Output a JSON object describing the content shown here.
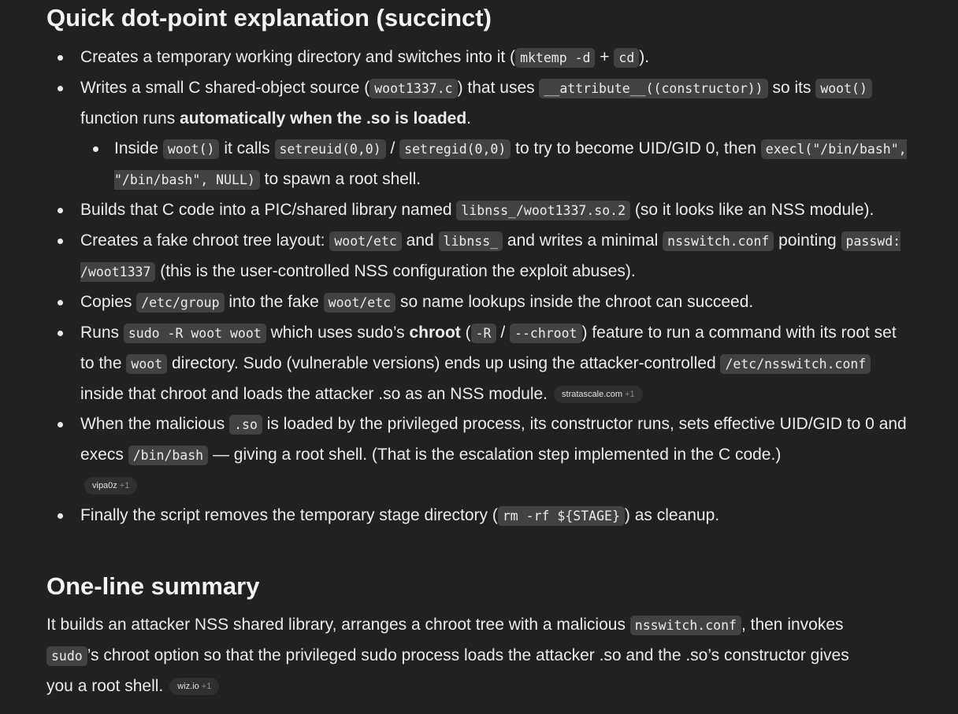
{
  "headings": {
    "explanation": "Quick dot-point explanation (succinct)",
    "summary": "One-line summary"
  },
  "b1": {
    "t1": "Creates a temporary working directory and switches into it (",
    "c1": "mktemp -d",
    "t2": " + ",
    "c2": "cd",
    "t3": ")."
  },
  "b2": {
    "t1": "Writes a small C shared-object source (",
    "c1": "woot1337.c",
    "t2": ") that uses ",
    "c2": "__attribute__((constructor))",
    "t3": " so its ",
    "c3": "woot()",
    "t4": " function runs ",
    "b1": "automatically when the .so is loaded",
    "t5": "."
  },
  "b2s": {
    "t1": "Inside ",
    "c1": "woot()",
    "t2": " it calls ",
    "c2": "setreuid(0,0)",
    "t3": " / ",
    "c3": "setregid(0,0)",
    "t4": " to try to become UID/GID 0, then ",
    "c4": "execl(\"/bin/bash\", \"/bin/bash\", NULL)",
    "t5": " to spawn a root shell."
  },
  "b3": {
    "t1": "Builds that C code into a PIC/shared library named ",
    "c1": "libnss_/woot1337.so.2",
    "t2": " (so it looks like an NSS module)."
  },
  "b4": {
    "t1": "Creates a fake chroot tree layout: ",
    "c1": "woot/etc",
    "t2": " and ",
    "c2": "libnss_",
    "t3": " and writes a minimal ",
    "c3": "nsswitch.conf",
    "t4": " pointing ",
    "c4": "passwd: /woot1337",
    "t5": " (this is the user-controlled NSS configuration the exploit abuses)."
  },
  "b5": {
    "t1": "Copies ",
    "c1": "/etc/group",
    "t2": " into the fake ",
    "c2": "woot/etc",
    "t3": " so name lookups inside the chroot can succeed."
  },
  "b6": {
    "t1": "Runs ",
    "c1": "sudo -R woot woot",
    "t2": " which uses sudo’s ",
    "b1": "chroot",
    "t3": " (",
    "c2": "-R",
    "t4": " / ",
    "c3": "--chroot",
    "t5": ") feature to run a command with its root set to the ",
    "c4": "woot",
    "t6": " directory. Sudo (vulnerable versions) ends up using the attacker-controlled ",
    "c5": "/etc/nsswitch.conf",
    "t7": " inside that chroot and loads the attacker .so as an NSS module."
  },
  "b7": {
    "t1": "When the malicious ",
    "c1": ".so",
    "t2": " is loaded by the privileged process, its constructor runs, sets effective UID/GID to 0 and execs ",
    "c2": "/bin/bash",
    "t3": " — giving a root shell. (That is the escalation step implemented in the C code.)"
  },
  "b8": {
    "t1": "Finally the script removes the temporary stage directory (",
    "c1": "rm -rf ${STAGE}",
    "t2": ") as cleanup."
  },
  "summary": {
    "t1": "It builds an attacker NSS shared library, arranges a chroot tree with a malicious ",
    "c1": "nsswitch.conf",
    "t2": ", then invokes ",
    "c2": "sudo",
    "t3": "’s chroot option so that the privileged sudo process loads the attacker .so and the .so’s constructor gives you a root shell."
  },
  "citations": {
    "stratascale": {
      "label": "stratascale.com",
      "more": "+1"
    },
    "vipa0z": {
      "label": "vipa0z",
      "more": "+1"
    },
    "wiz": {
      "label": "wiz.io",
      "more": "+1"
    }
  }
}
